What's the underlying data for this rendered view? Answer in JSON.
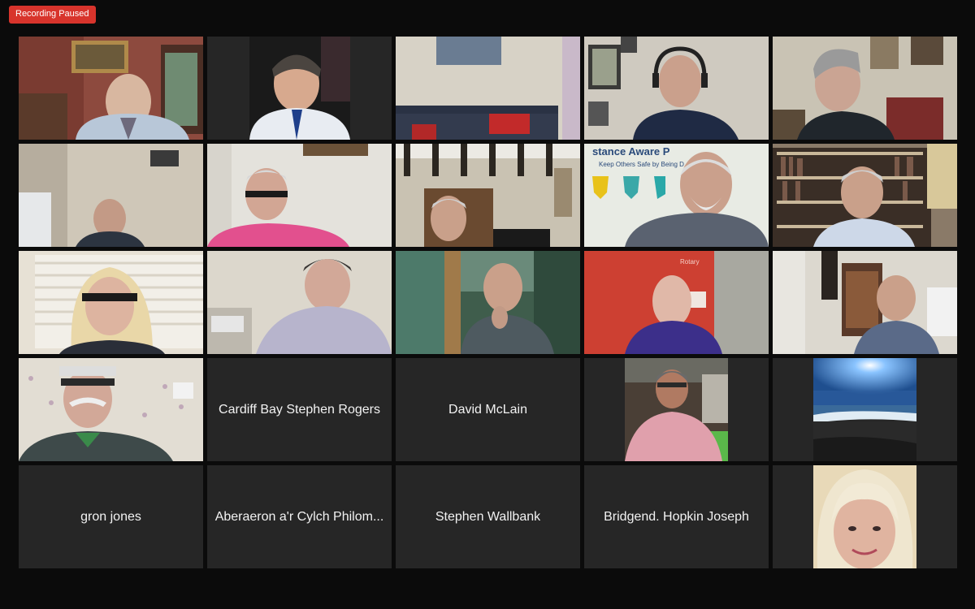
{
  "recording": {
    "status_label": "Recording Paused",
    "color": "#d8342c"
  },
  "gallery": {
    "video_tiles": [
      {
        "id": "p1",
        "background": "#8d4a3e"
      },
      {
        "id": "p2",
        "background": "#1e1e1e"
      },
      {
        "id": "p3",
        "background": "#d7d2c6"
      },
      {
        "id": "p4",
        "background": "#cfcac0"
      },
      {
        "id": "p5",
        "background": "#c9c3b4"
      },
      {
        "id": "p6",
        "background": "#cfc7b8"
      },
      {
        "id": "p7",
        "background": "#e4e2dc"
      },
      {
        "id": "p8",
        "background": "#c9c2b2"
      },
      {
        "id": "p9",
        "background": "#e8ebe4"
      },
      {
        "id": "p10",
        "background": "#8a7a68"
      },
      {
        "id": "p11",
        "background": "#e7e1d5"
      },
      {
        "id": "p12",
        "background": "#dcd7cc"
      },
      {
        "id": "p13",
        "background": "#3f5d4c"
      },
      {
        "id": "p14",
        "background": "#c4342a"
      },
      {
        "id": "p15",
        "background": "#dcd8cf"
      },
      {
        "id": "p16",
        "background": "#e2ddd3"
      }
    ],
    "name_tiles": [
      {
        "name": "Cardiff Bay Stephen Rogers"
      },
      {
        "name": "David McLain"
      },
      {
        "name": "gron jones"
      },
      {
        "name": "Aberaeron a'r Cylch Philom..."
      },
      {
        "name": "Stephen Wallbank"
      },
      {
        "name": "Bridgend. Hopkin Joseph"
      }
    ],
    "photo_tiles": [
      {
        "id": "photo-man-pink-shirt",
        "background": "#4a3f36"
      },
      {
        "id": "photo-beach-sky",
        "background": "#1f4f8f"
      },
      {
        "id": "photo-blonde-woman",
        "background": "#e8d9b8"
      }
    ],
    "overlay_text": {
      "sign_text": "stance Aware P",
      "sign_subtext": "Keep Others Safe by Being D",
      "banner_text": "Rotary"
    }
  }
}
